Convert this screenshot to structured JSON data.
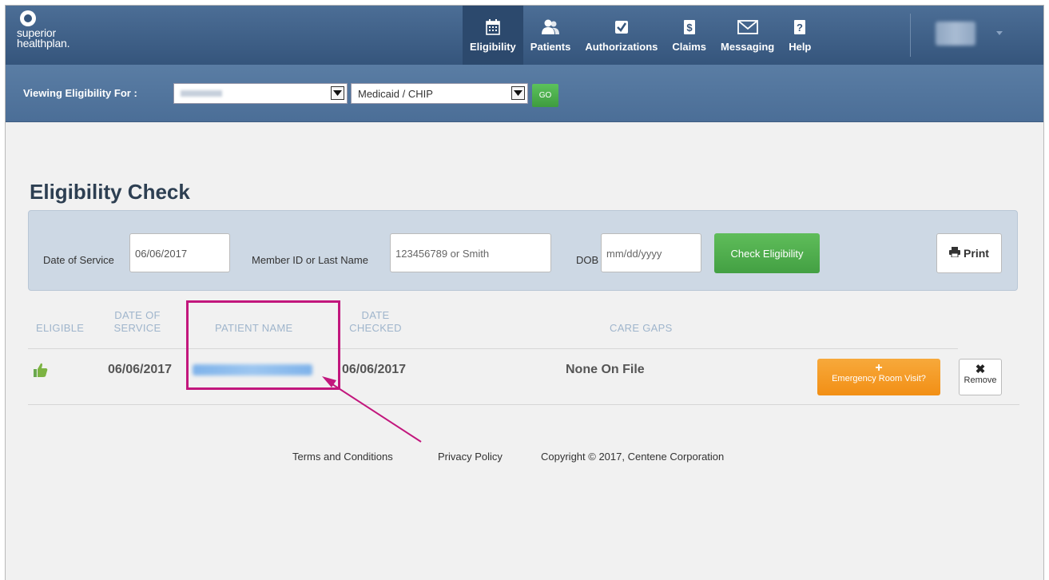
{
  "brand": {
    "line1": "superior",
    "line2": "healthplan."
  },
  "nav": {
    "items": [
      {
        "label": "Eligibility",
        "icon": "calendar-icon",
        "active": true
      },
      {
        "label": "Patients",
        "icon": "patients-icon",
        "active": false
      },
      {
        "label": "Authorizations",
        "icon": "checkbox-icon",
        "active": false
      },
      {
        "label": "Claims",
        "icon": "dollar-icon",
        "active": false
      },
      {
        "label": "Messaging",
        "icon": "envelope-icon",
        "active": false
      },
      {
        "label": "Help",
        "icon": "help-icon",
        "active": false
      }
    ]
  },
  "subbar": {
    "label": "Viewing Eligibility For :",
    "plan_value": "Medicaid / CHIP",
    "go_label": "GO"
  },
  "page": {
    "title": "Eligibility Check"
  },
  "filters": {
    "date_label": "Date of Service",
    "date_value": "06/06/2017",
    "member_label": "Member ID or Last Name",
    "member_placeholder": "123456789 or Smith",
    "dob_label": "DOB",
    "dob_placeholder": "mm/dd/yyyy",
    "check_label": "Check Eligibility",
    "print_label": "Print"
  },
  "table": {
    "headers": {
      "eligible": "ELIGIBLE",
      "date_of_service_1": "DATE OF",
      "date_of_service_2": "SERVICE",
      "patient_name": "PATIENT NAME",
      "date_checked_1": "DATE",
      "date_checked_2": "CHECKED",
      "care_gaps": "CARE GAPS"
    },
    "row": {
      "date_of_service": "06/06/2017",
      "date_checked": "06/06/2017",
      "care_gaps": "None On File",
      "er_label": "Emergency Room Visit?",
      "remove_label": "Remove"
    }
  },
  "footer": {
    "terms": "Terms and Conditions",
    "privacy": "Privacy Policy",
    "copyright": "Copyright © 2017, Centene Corporation"
  },
  "colors": {
    "nav_bg": "#35557c",
    "accent_green": "#43a043",
    "accent_orange": "#f28f15",
    "highlight": "#c2177d"
  }
}
